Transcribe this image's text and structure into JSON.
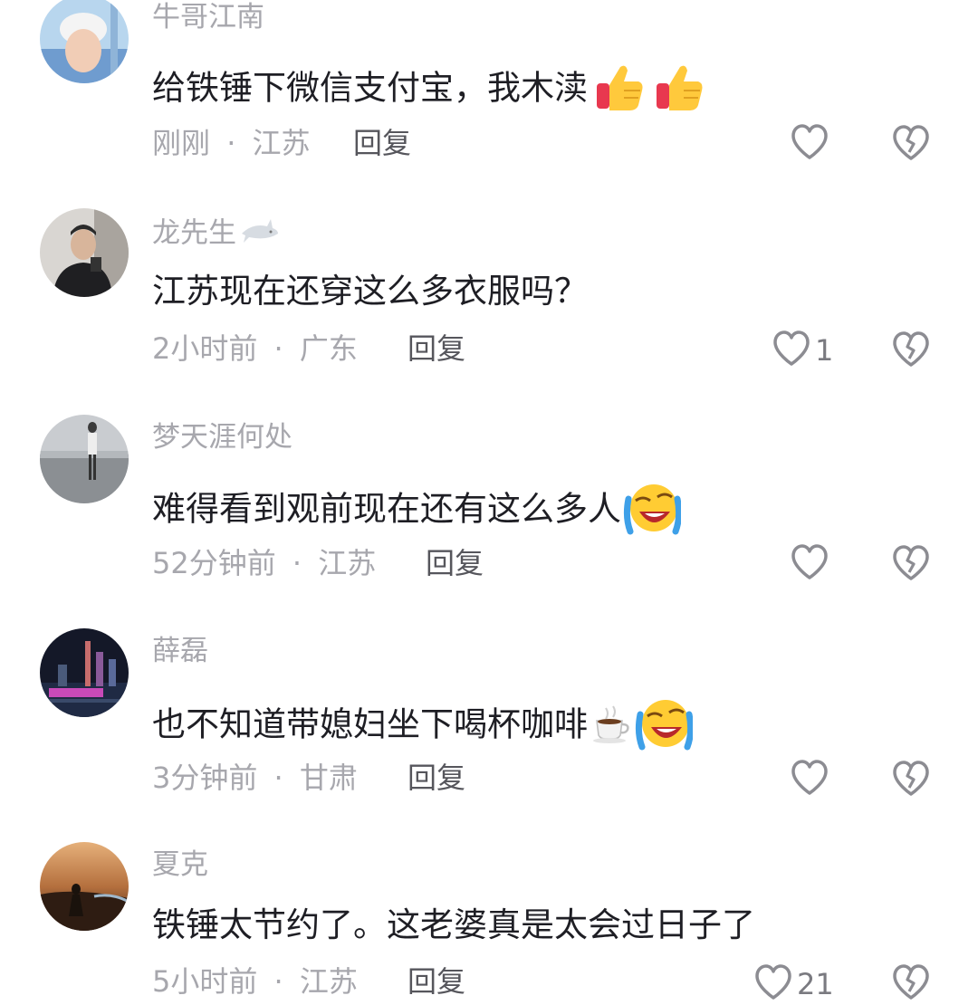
{
  "comments": [
    {
      "username": "牛哥江南",
      "text": "给铁锤下微信支付宝，我木渎",
      "time": "刚刚",
      "location": "江苏",
      "reply": "回复",
      "likes": "",
      "emoji": [
        "thumbs-up",
        "thumbs-up"
      ]
    },
    {
      "username": "龙先生",
      "text": "江苏现在还穿这么多衣服吗？",
      "time": "2小时前",
      "location": "广东",
      "reply": "回复",
      "likes": "1",
      "emoji": []
    },
    {
      "username": "梦天涯何处",
      "text": "难得看到观前现在还有这么多人",
      "time": "52分钟前",
      "location": "江苏",
      "reply": "回复",
      "likes": "",
      "emoji": [
        "loudly-crying-face"
      ]
    },
    {
      "username": "薛磊",
      "text": "也不知道带媳妇坐下喝杯咖啡",
      "time": "3分钟前",
      "location": "甘肃",
      "reply": "回复",
      "likes": "",
      "emoji": [
        "coffee",
        "loudly-crying-face"
      ]
    },
    {
      "username": "夏克",
      "text": "铁锤太节约了。这老婆真是太会过日子了",
      "time": "5小时前",
      "location": "江苏",
      "reply": "回复",
      "likes": "21",
      "emoji": []
    }
  ],
  "separator": "·",
  "colors": {
    "text": "#1e1e24",
    "secondary": "#a7a7ad",
    "reply": "#56565c",
    "icon": "#8c8c92"
  }
}
